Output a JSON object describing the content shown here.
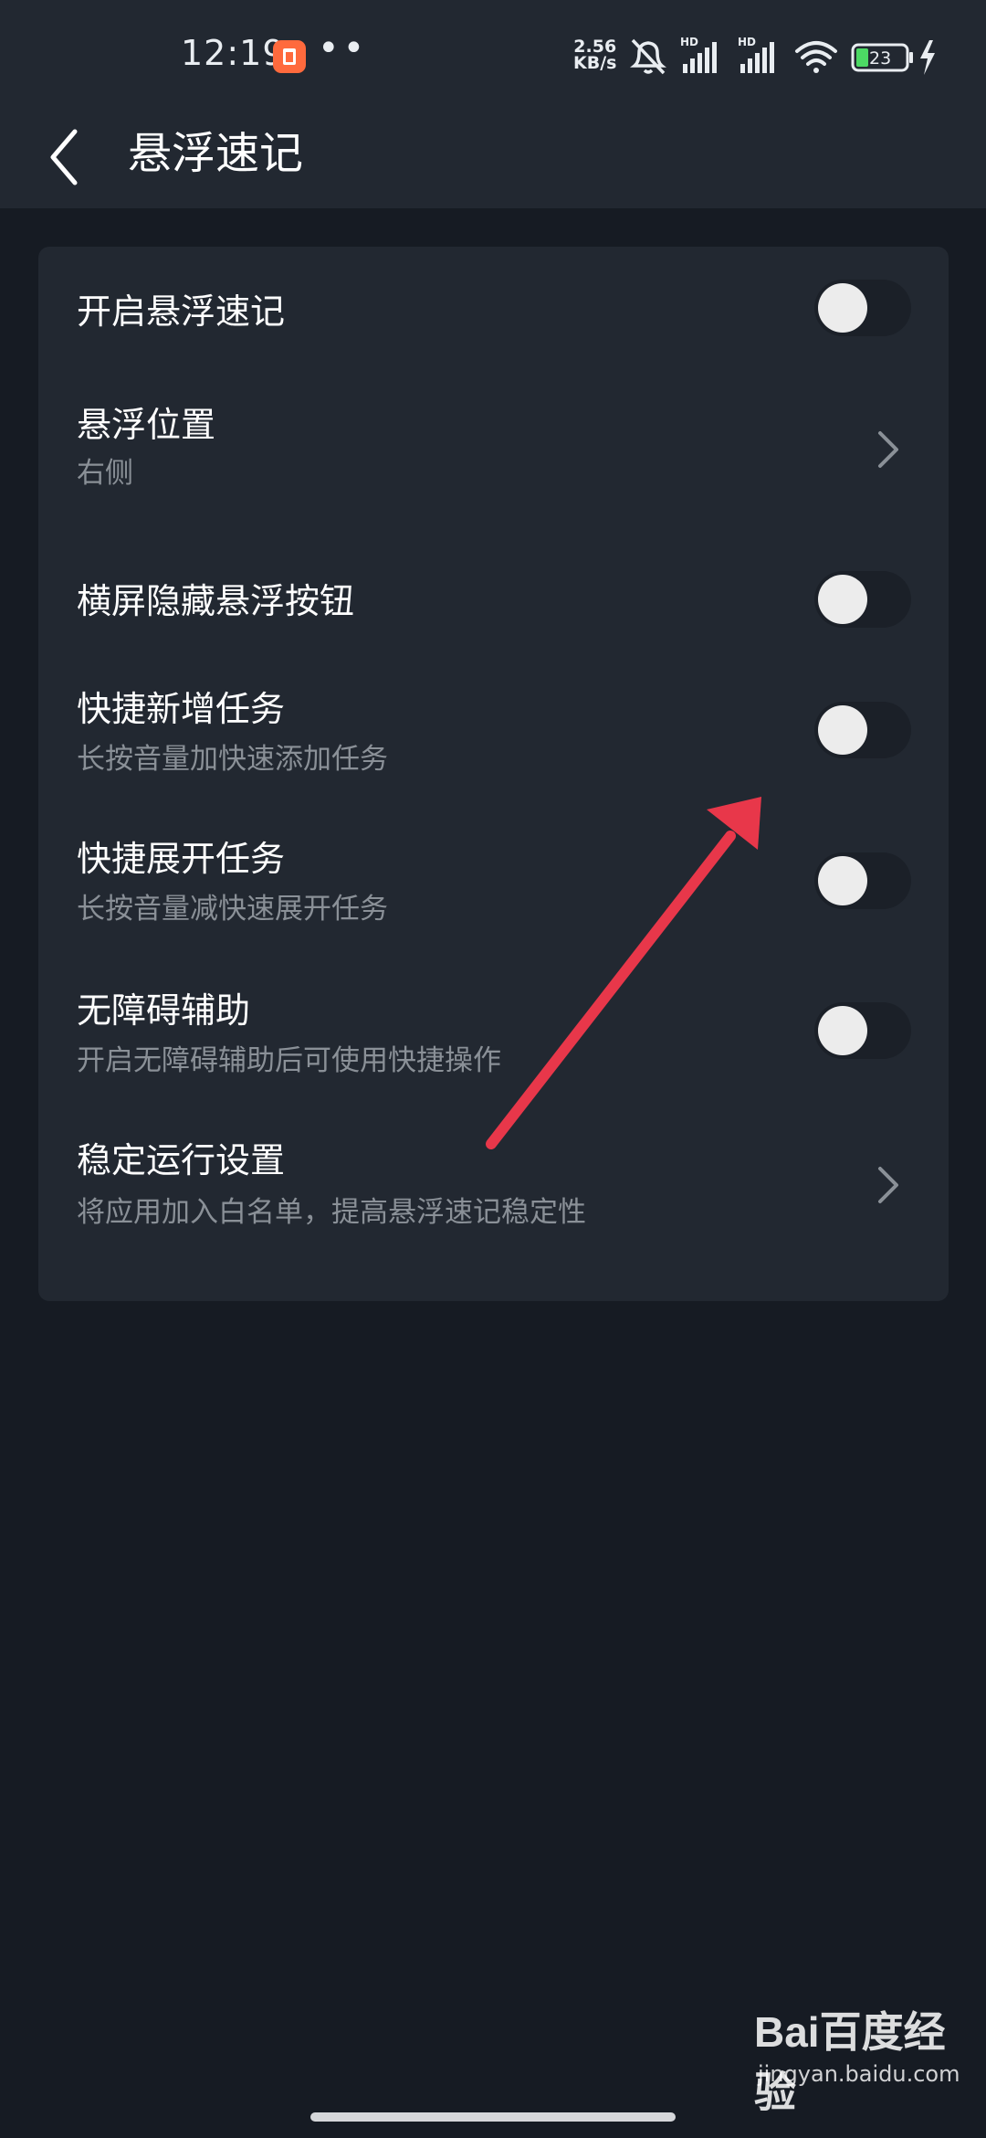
{
  "status_bar": {
    "time": "12:19",
    "dots": "••",
    "network_speed_value": "2.56",
    "network_speed_unit": "KB/s",
    "battery_level": "23",
    "signal_labels": [
      "HD",
      "HD"
    ]
  },
  "header": {
    "title": "悬浮速记"
  },
  "settings": [
    {
      "title": "开启悬浮速记",
      "subtitle": "",
      "control": "toggle",
      "on": false
    },
    {
      "title": "悬浮位置",
      "subtitle": "右侧",
      "control": "chevron"
    },
    {
      "title": "横屏隐藏悬浮按钮",
      "subtitle": "",
      "control": "toggle",
      "on": false
    },
    {
      "title": "快捷新增任务",
      "subtitle": "长按音量加快速添加任务",
      "control": "toggle",
      "on": false
    },
    {
      "title": "快捷展开任务",
      "subtitle": "长按音量减快速展开任务",
      "control": "toggle",
      "on": false
    },
    {
      "title": "无障碍辅助",
      "subtitle": "开启无障碍辅助后可使用快捷操作",
      "control": "toggle",
      "on": false
    },
    {
      "title": "稳定运行设置",
      "subtitle": "将应用加入白名单，提高悬浮速记稳定性",
      "control": "chevron"
    }
  ],
  "watermark": {
    "logo_text": "Bai百度经验",
    "url": "jingyan.baidu.com"
  },
  "colors": {
    "background": "#161b23",
    "card": "#222831",
    "subtitle": "#8a9097",
    "toggle_track": "#1b2028",
    "toggle_knob": "#ececec",
    "annotation": "#e8374a"
  }
}
